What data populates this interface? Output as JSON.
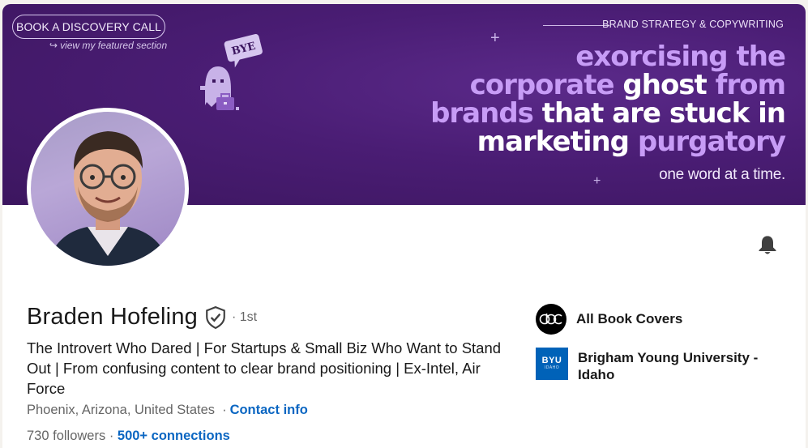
{
  "banner": {
    "cta_button": "BOOK A DISCOVERY CALL",
    "cta_subtext": "view my featured section",
    "tagline": "BRAND STRATEGY & COPYWRITING",
    "headline_lines": [
      [
        {
          "t": "exorcising the",
          "w": false
        }
      ],
      [
        {
          "t": "corporate ",
          "w": false
        },
        {
          "t": "ghost",
          "w": true
        },
        {
          "t": " from",
          "w": false
        }
      ],
      [
        {
          "t": "brands ",
          "w": false
        },
        {
          "t": "that are stuck in",
          "w": true
        }
      ],
      [
        {
          "t": "marketing ",
          "w": true
        },
        {
          "t": "purgatory",
          "w": false
        }
      ]
    ],
    "tail": "one word at a time.",
    "ghost_bubble": "BYE",
    "colors": {
      "background": "#4a1d74",
      "accent": "#c79cf6"
    }
  },
  "profile": {
    "name": "Braden Hofeling",
    "degree": "· 1st",
    "headline": "The Introvert Who Dared | For Startups & Small Biz Who Want to Stand Out | From confusing content to clear brand positioning | Ex-Intel, Air Force",
    "location": "Phoenix, Arizona, United States",
    "contact_info": "Contact info",
    "followers": "730 followers",
    "connections": "500+ connections"
  },
  "orgs": [
    {
      "name": "All Book Covers",
      "logo": "abc"
    },
    {
      "name": "Brigham Young University - Idaho",
      "logo_text": "BYU",
      "logo_subtext": "IDAHO"
    }
  ],
  "icons": {
    "bell": "bell-icon",
    "verified": "verified-shield-icon",
    "arrow": "return-arrow-icon"
  },
  "colors": {
    "link": "#0a66c2",
    "text": "#191919",
    "muted": "#666666"
  }
}
